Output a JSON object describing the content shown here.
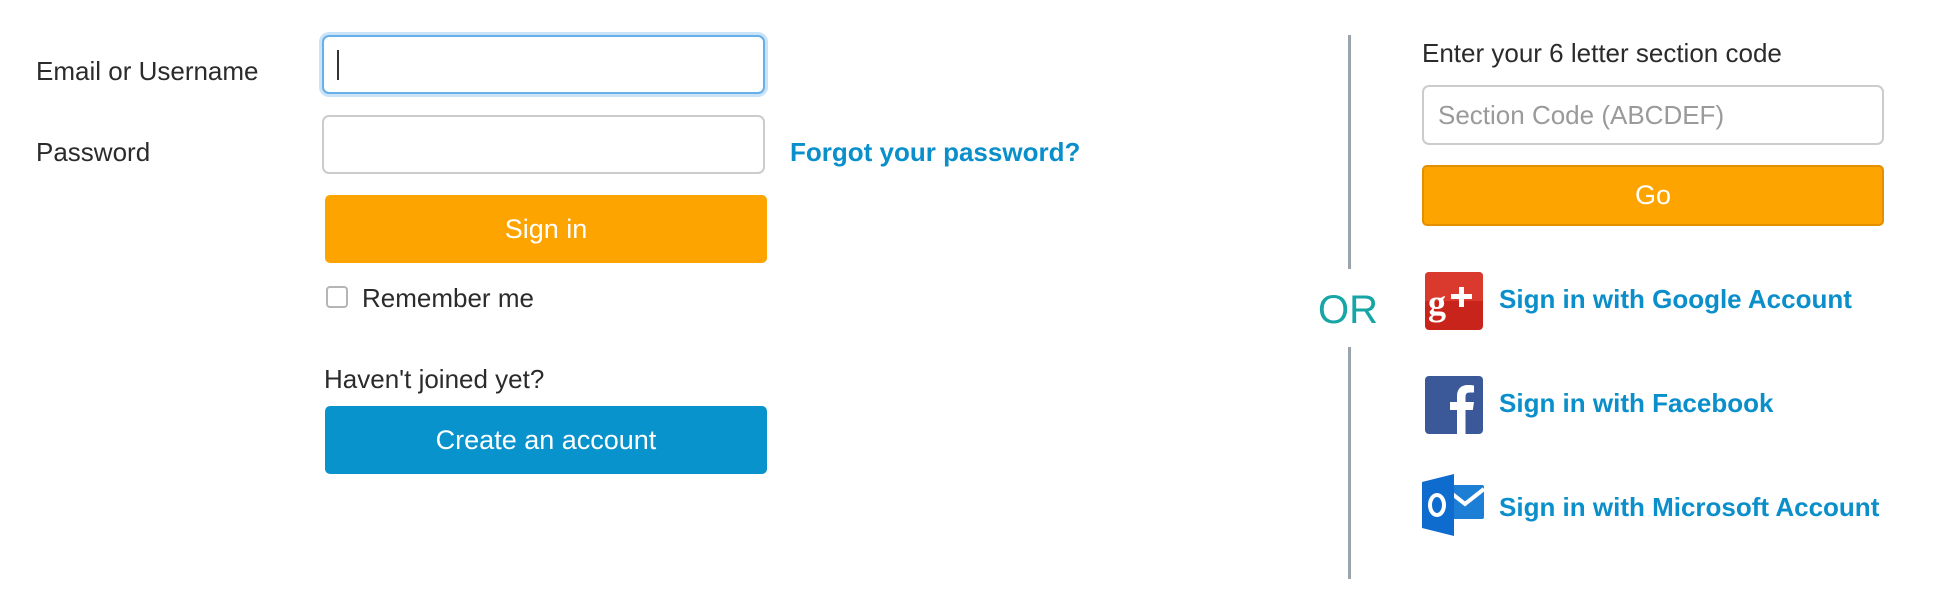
{
  "login": {
    "email_label": "Email or Username",
    "email_value": "",
    "password_label": "Password",
    "password_value": "",
    "forgot_link": "Forgot your password?",
    "signin_button": "Sign in",
    "remember_label": "Remember me",
    "remember_checked": false,
    "not_joined_text": "Haven't joined yet?",
    "create_account_button": "Create an account"
  },
  "separator": {
    "or_text": "OR"
  },
  "section": {
    "prompt": "Enter your 6 letter section code",
    "placeholder": "Section Code (ABCDEF)",
    "go_button": "Go"
  },
  "social": {
    "google": {
      "label": "Sign in with Google Account",
      "icon": "google-plus-icon",
      "color": "#c8241b"
    },
    "facebook": {
      "label": "Sign in with Facebook",
      "icon": "facebook-icon",
      "color": "#3b5998"
    },
    "microsoft": {
      "label": "Sign in with Microsoft Account",
      "icon": "outlook-icon",
      "color": "#0f6ccf"
    }
  },
  "colors": {
    "orange": "#fda401",
    "blue": "#0893cc",
    "link": "#0a8fcb",
    "or": "#17a5a6",
    "divider": "#9ba4ac"
  }
}
